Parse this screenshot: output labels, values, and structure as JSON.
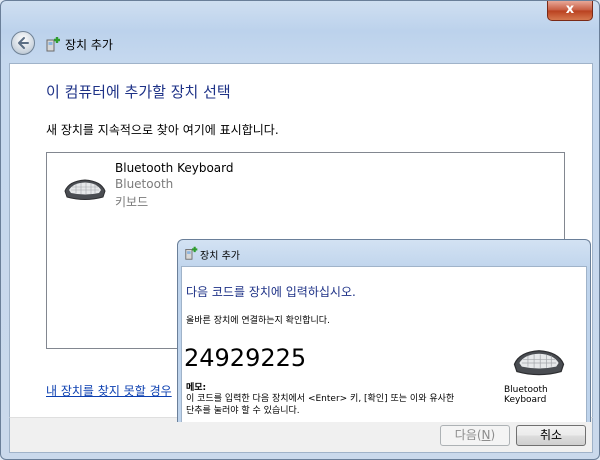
{
  "window": {
    "title": "장치 추가",
    "close_glyph": "x"
  },
  "main": {
    "heading": "이 컴퓨터에 추가할 장치 선택",
    "description": "새 장치를 지속적으로 찾아 여기에 표시합니다.",
    "devices": [
      {
        "name": "Bluetooth Keyboard",
        "type": "Bluetooth",
        "category": "키보드"
      }
    ],
    "not_found_link": "내 장치를 찾지 못할 경우"
  },
  "footer": {
    "next_label": "다음(",
    "next_accel": "N",
    "next_close": ")",
    "cancel_label": "취소"
  },
  "popup": {
    "title": "장치 추가",
    "heading": "다음 코드를 장치에 입력하십시오.",
    "description": "올바른 장치에 연결하는지 확인합니다.",
    "pairing_code": "24929225",
    "memo_label": "메모:",
    "memo_line1": "이 코드를 입력한 다음 장치에서 <Enter> 키, [확인] 또는 이와 유사한",
    "memo_line2": "단추를 눌러야 할 수 있습니다.",
    "device_label": "Bluetooth Keyboard"
  },
  "colors": {
    "heading_blue": "#1e3287",
    "link_blue": "#0b3fb0",
    "close_red": "#c65a3e"
  },
  "icons": [
    "back-arrow-icon",
    "device-wizard-icon",
    "keyboard-icon",
    "close-icon"
  ]
}
